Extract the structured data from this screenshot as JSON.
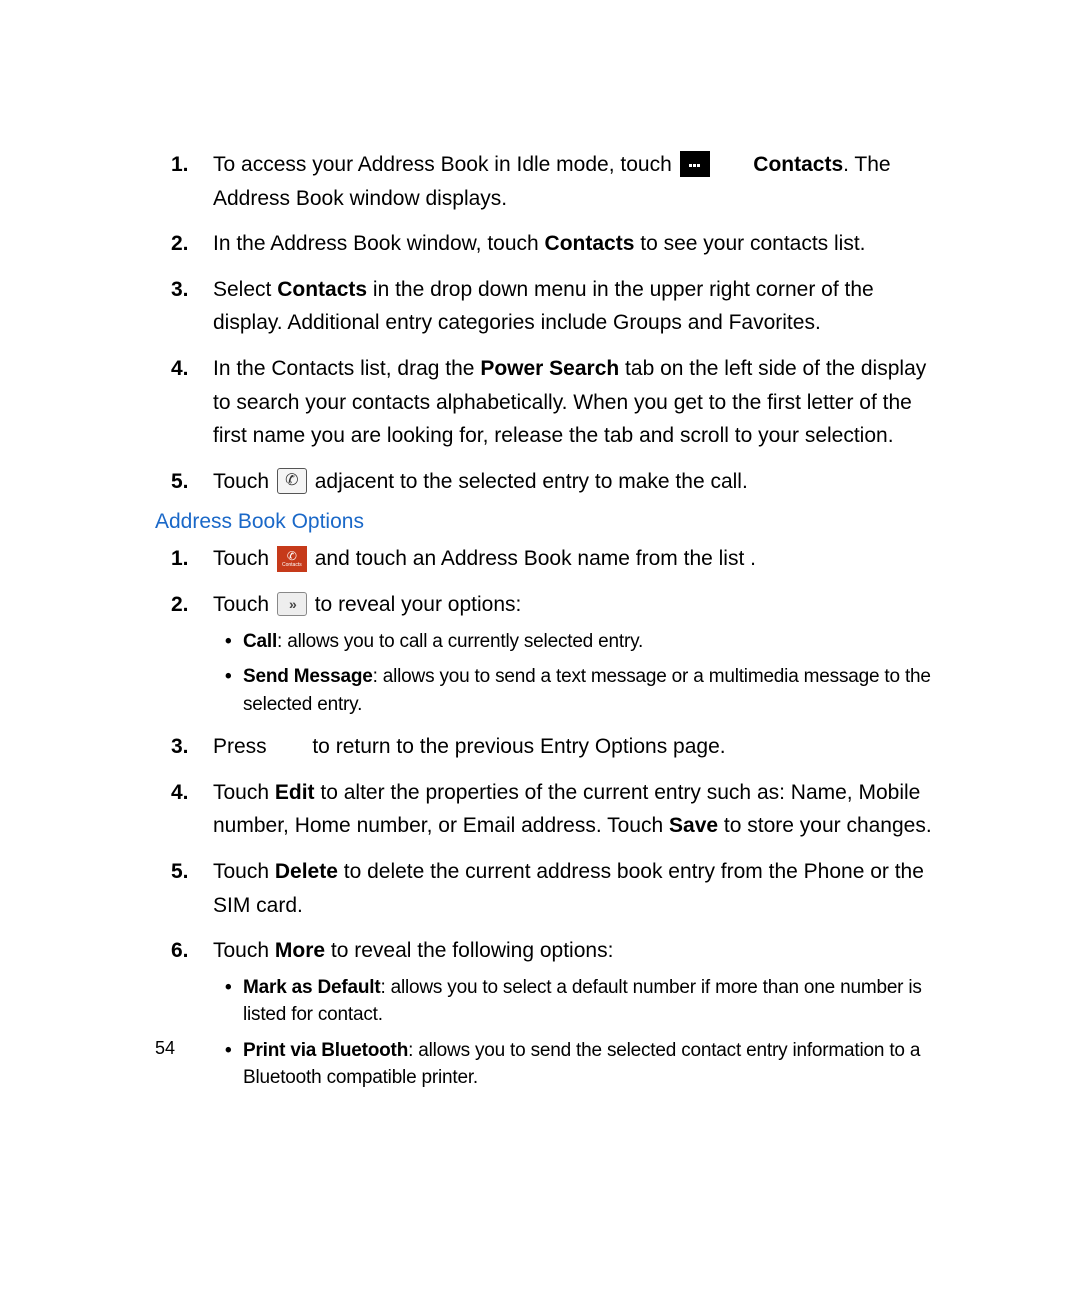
{
  "section1": {
    "items": [
      {
        "num": "1.",
        "pre": "To access your Address Book in Idle mode, touch ",
        "icon": "menu",
        "mid": "",
        "bold1": "Contacts",
        "post": ". The Address Book window displays."
      },
      {
        "num": "2.",
        "pre": "In the Address Book window, touch ",
        "bold1": "Contacts",
        "post": " to see your contacts list."
      },
      {
        "num": "3.",
        "pre": "Select ",
        "bold1": "Contacts",
        "post": " in the drop down menu in the upper right corner of the display. Additional entry categories include Groups and Favorites."
      },
      {
        "num": "4.",
        "pre": "In the Contacts list, drag the ",
        "bold1": "Power Search",
        "post": " tab on the left side of the display to search your contacts alphabetically. When you get to the first letter of the first name you are looking for, release the tab and scroll to your selection."
      },
      {
        "num": "5.",
        "pre": "Touch ",
        "icon": "call",
        "post": " adjacent to the selected entry to make the call."
      }
    ]
  },
  "heading": "Address Book Options",
  "section2": {
    "items": [
      {
        "num": "1.",
        "pre": "Touch ",
        "icon": "contacts",
        "post": " and touch an Address Book name from the list ."
      },
      {
        "num": "2.",
        "pre": "Touch ",
        "icon": "more",
        "post": " to reveal your options:",
        "bullets": [
          {
            "bold": "Call",
            "text": ": allows you to call a currently selected entry."
          },
          {
            "bold": "Send Message",
            "text": ": allows you to send a text message or a multimedia message to the selected entry."
          }
        ]
      },
      {
        "num": "3.",
        "pre": "Press ",
        "gap": true,
        "post": " to return to the previous Entry Options page."
      },
      {
        "num": "4.",
        "pre": "Touch ",
        "bold1": "Edit",
        "mid": " to alter the properties of the current entry such as: Name, Mobile number, Home number, or Email address. Touch ",
        "bold2": "Save",
        "post": " to store your changes."
      },
      {
        "num": "5.",
        "pre": "Touch ",
        "bold1": "Delete",
        "post": " to delete the current address book entry from the Phone or the SIM card."
      },
      {
        "num": "6.",
        "pre": "Touch ",
        "bold1": "More",
        "post": " to reveal the following options:",
        "bullets": [
          {
            "bold": "Mark as Default",
            "text": ": allows you to select a default number if more than one number is listed for contact."
          },
          {
            "bold": "Print via Bluetooth",
            "text": ": allows you to send the selected contact entry information to a Bluetooth compatible printer."
          }
        ]
      }
    ]
  },
  "icons": {
    "menu_label": "Menu",
    "contacts_label": "Contacts"
  },
  "page_number": "54"
}
